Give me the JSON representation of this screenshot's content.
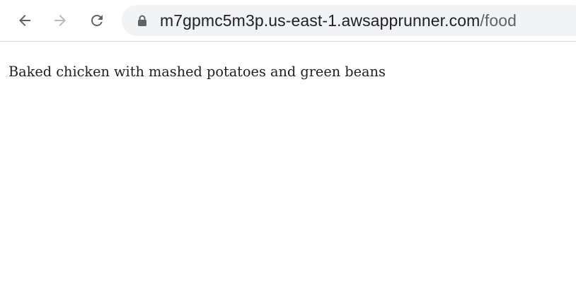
{
  "browser": {
    "icons": {
      "back": "arrow-left-icon",
      "forward": "arrow-right-icon",
      "reload": "reload-icon",
      "security": "lock-icon"
    },
    "address_bar": {
      "host": "m7gpmc5m3p.us-east-1.awsapprunner.com",
      "path": "/food"
    }
  },
  "page": {
    "text": "Baked chicken with mashed potatoes and green beans"
  },
  "colors": {
    "icon_active": "#5f6368",
    "icon_disabled": "#b8babd",
    "omnibox_bg": "#f1f3f4",
    "text": "#202124"
  }
}
